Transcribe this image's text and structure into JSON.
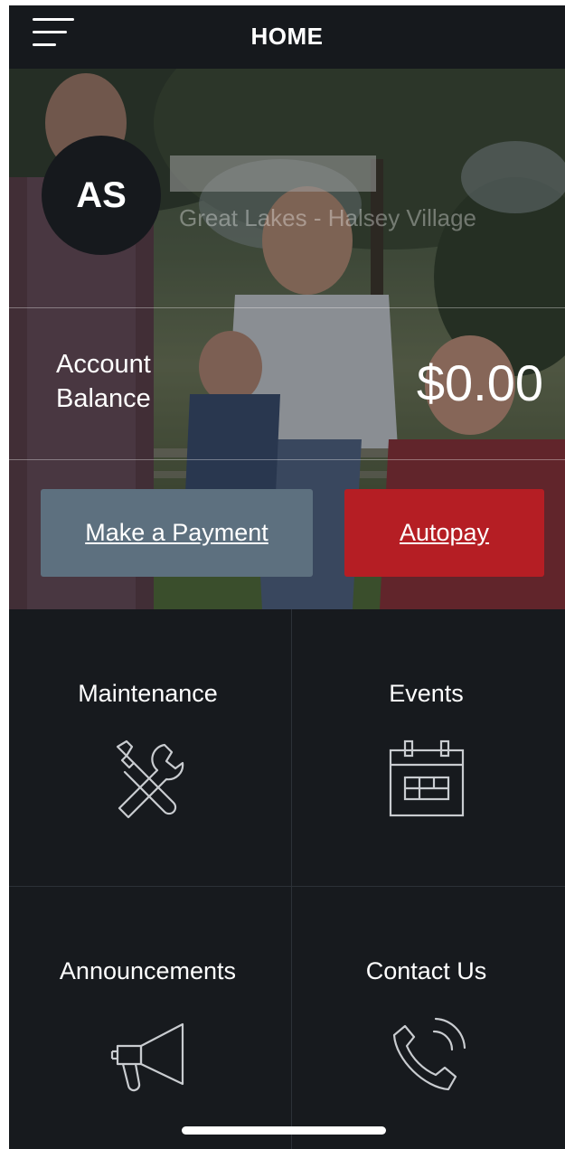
{
  "header": {
    "title": "HOME",
    "menu_icon": "hamburger-menu-icon"
  },
  "profile": {
    "initials": "AS",
    "community": "Great Lakes - Halsey Village"
  },
  "account": {
    "balance_label": "Account Balance",
    "balance_value": "$0.00"
  },
  "actions": {
    "make_payment": "Make a Payment",
    "autopay": "Autopay"
  },
  "tiles": [
    {
      "label": "Maintenance",
      "icon": "tools-icon"
    },
    {
      "label": "Events",
      "icon": "calendar-icon"
    },
    {
      "label": "Announcements",
      "icon": "megaphone-icon"
    },
    {
      "label": "Contact Us",
      "icon": "phone-icon"
    }
  ],
  "colors": {
    "background": "#171a1e",
    "pay_button": "#5d707f",
    "autopay_button": "#b51e24",
    "text": "#ffffff"
  }
}
